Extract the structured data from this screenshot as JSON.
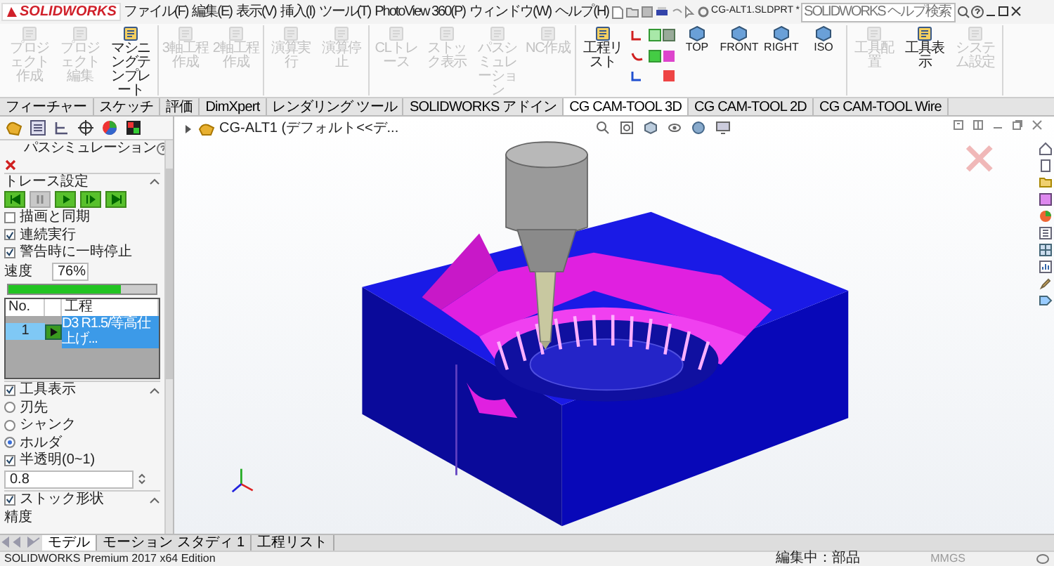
{
  "title_bar": {
    "logo": "SOLIDWORKS",
    "menu": [
      "ファイル(F)",
      "編集(E)",
      "表示(V)",
      "挿入(I)",
      "ツール(T)",
      "PhotoView 360(P)",
      "ウィンドウ(W)",
      "ヘルプ(H)"
    ],
    "document_title": "CG-ALT1.SLDPRT *",
    "search": {
      "placeholder": "SOLIDWORKS ヘルプ検索"
    }
  },
  "ribbon_groups": [
    {
      "buttons": [
        {
          "label": "プロジェクト作成",
          "kind": "command",
          "disabled": true
        },
        {
          "label": "プロジェクト編集",
          "kind": "command",
          "disabled": true
        },
        {
          "label": "マシニングテンプレート",
          "kind": "command",
          "disabled": false
        }
      ]
    },
    {
      "buttons": [
        {
          "label": "3軸工程作成",
          "kind": "command",
          "disabled": true
        },
        {
          "label": "2軸工程作成",
          "kind": "command",
          "disabled": true
        }
      ]
    },
    {
      "buttons": [
        {
          "label": "演算実行",
          "kind": "command",
          "disabled": true
        },
        {
          "label": "演算停止",
          "kind": "command",
          "disabled": true
        }
      ]
    },
    {
      "buttons": [
        {
          "label": "CLトレース",
          "kind": "command",
          "disabled": true
        },
        {
          "label": "ストック表示",
          "kind": "command",
          "disabled": true
        },
        {
          "label": "パスシミュレーション",
          "kind": "command",
          "disabled": true
        },
        {
          "label": "NC作成",
          "kind": "command",
          "disabled": true
        }
      ]
    },
    {
      "buttons": [
        {
          "label": "工程リスト",
          "kind": "command",
          "disabled": false
        },
        {
          "kind": "arrows"
        },
        {
          "label": "TOP",
          "kind": "view",
          "disabled": false
        },
        {
          "label": "FRONT",
          "kind": "view",
          "disabled": false
        },
        {
          "label": "RIGHT",
          "kind": "view",
          "disabled": false
        },
        {
          "label": "ISO",
          "kind": "view",
          "disabled": false
        }
      ]
    },
    {
      "buttons": [
        {
          "label": "工具配置",
          "kind": "command",
          "disabled": true
        },
        {
          "label": "工具表示",
          "kind": "command",
          "disabled": false
        },
        {
          "label": "システム設定",
          "kind": "command",
          "disabled": true
        }
      ]
    }
  ],
  "tabs": [
    {
      "label": "フィーチャー",
      "selected": false
    },
    {
      "label": "スケッチ",
      "selected": false
    },
    {
      "label": "評価",
      "selected": false
    },
    {
      "label": "DimXpert",
      "selected": false
    },
    {
      "label": "レンダリング ツール",
      "selected": false
    },
    {
      "label": "SOLIDWORKS アドイン",
      "selected": false
    },
    {
      "label": "CG CAM-TOOL 3D",
      "selected": true
    },
    {
      "label": "CG CAM-TOOL 2D",
      "selected": false
    },
    {
      "label": "CG CAM-TOOL Wire",
      "selected": false
    }
  ],
  "panel": {
    "title": "パスシミュレーション",
    "trace": {
      "heading": "トレース設定",
      "controls": [
        {
          "kind": "first",
          "disabled": false
        },
        {
          "kind": "pause",
          "disabled": true
        },
        {
          "kind": "play",
          "disabled": false
        },
        {
          "kind": "step",
          "disabled": false
        },
        {
          "kind": "last",
          "disabled": false
        }
      ],
      "options": [
        {
          "label": "描画と同期",
          "checked": false
        },
        {
          "label": "連続実行",
          "checked": true
        },
        {
          "label": "警告時に一時停止",
          "checked": true
        }
      ],
      "speed": {
        "label": "速度",
        "value": "76%",
        "level": 0.76
      },
      "table": {
        "columns": [
          "No.",
          "工程"
        ],
        "rows": [
          {
            "no": "1",
            "process": "D3 R1.5/等高仕上げ...",
            "selected": true
          }
        ]
      }
    },
    "tool_display": {
      "label": "工具表示",
      "checked": true,
      "modes": [
        {
          "label": "刃先",
          "selected": false
        },
        {
          "label": "シャンク",
          "selected": false
        },
        {
          "label": "ホルダ",
          "selected": true
        }
      ],
      "transparency": {
        "label": "半透明(0~1)",
        "checked": true,
        "value": "0.8"
      }
    },
    "stock": {
      "label": "ストック形状",
      "checked": true,
      "field_label": "精度"
    }
  },
  "bottom_tabs": [
    {
      "label": "モデル",
      "selected": true
    },
    {
      "label": "モーション スタディ 1",
      "selected": false
    },
    {
      "label": "工程リスト",
      "selected": false
    }
  ],
  "viewport": {
    "breadcrumb": "CG-ALT1 (デフォルト<<デ..."
  },
  "status_bar": {
    "edition": "SOLIDWORKS Premium 2017 x64 Edition",
    "mode": "編集中：部品",
    "units": "MMGS"
  }
}
